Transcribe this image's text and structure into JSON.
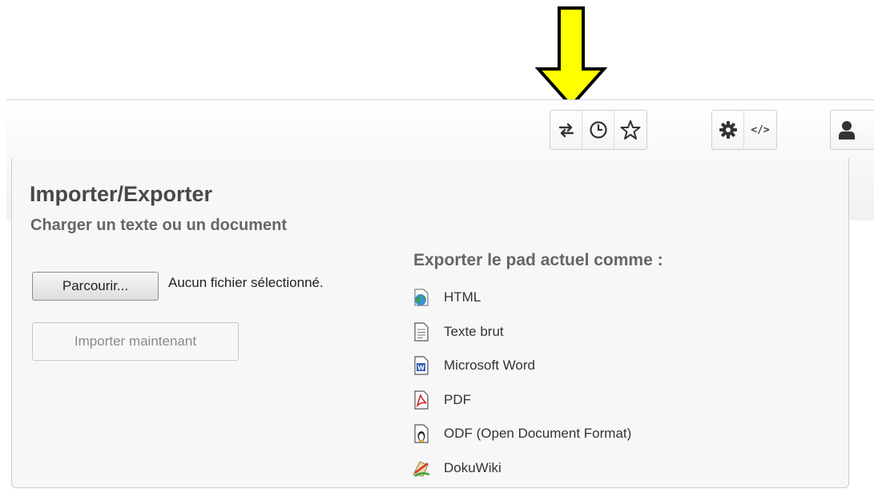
{
  "toolbar": {
    "icons": [
      "import-export-icon",
      "history-icon",
      "star-icon",
      "settings-icon",
      "embed-code-icon",
      "user-icon"
    ],
    "embed_label": "</>"
  },
  "annotation": {
    "arrow_color": "#ffff00"
  },
  "popup": {
    "title": "Importer/Exporter",
    "import_heading": "Charger un texte ou un document",
    "browse_label": "Parcourir...",
    "no_file_text": "Aucun fichier sélectionné.",
    "import_now_label": "Importer maintenant",
    "export_heading": "Exporter le pad actuel comme :",
    "export_formats": [
      {
        "label": "HTML",
        "icon": "globe-icon"
      },
      {
        "label": "Texte brut",
        "icon": "text-file-icon"
      },
      {
        "label": "Microsoft Word",
        "icon": "word-file-icon"
      },
      {
        "label": "PDF",
        "icon": "pdf-file-icon"
      },
      {
        "label": "ODF (Open Document Format)",
        "icon": "odf-file-icon"
      },
      {
        "label": "DokuWiki",
        "icon": "dokuwiki-icon"
      }
    ]
  }
}
